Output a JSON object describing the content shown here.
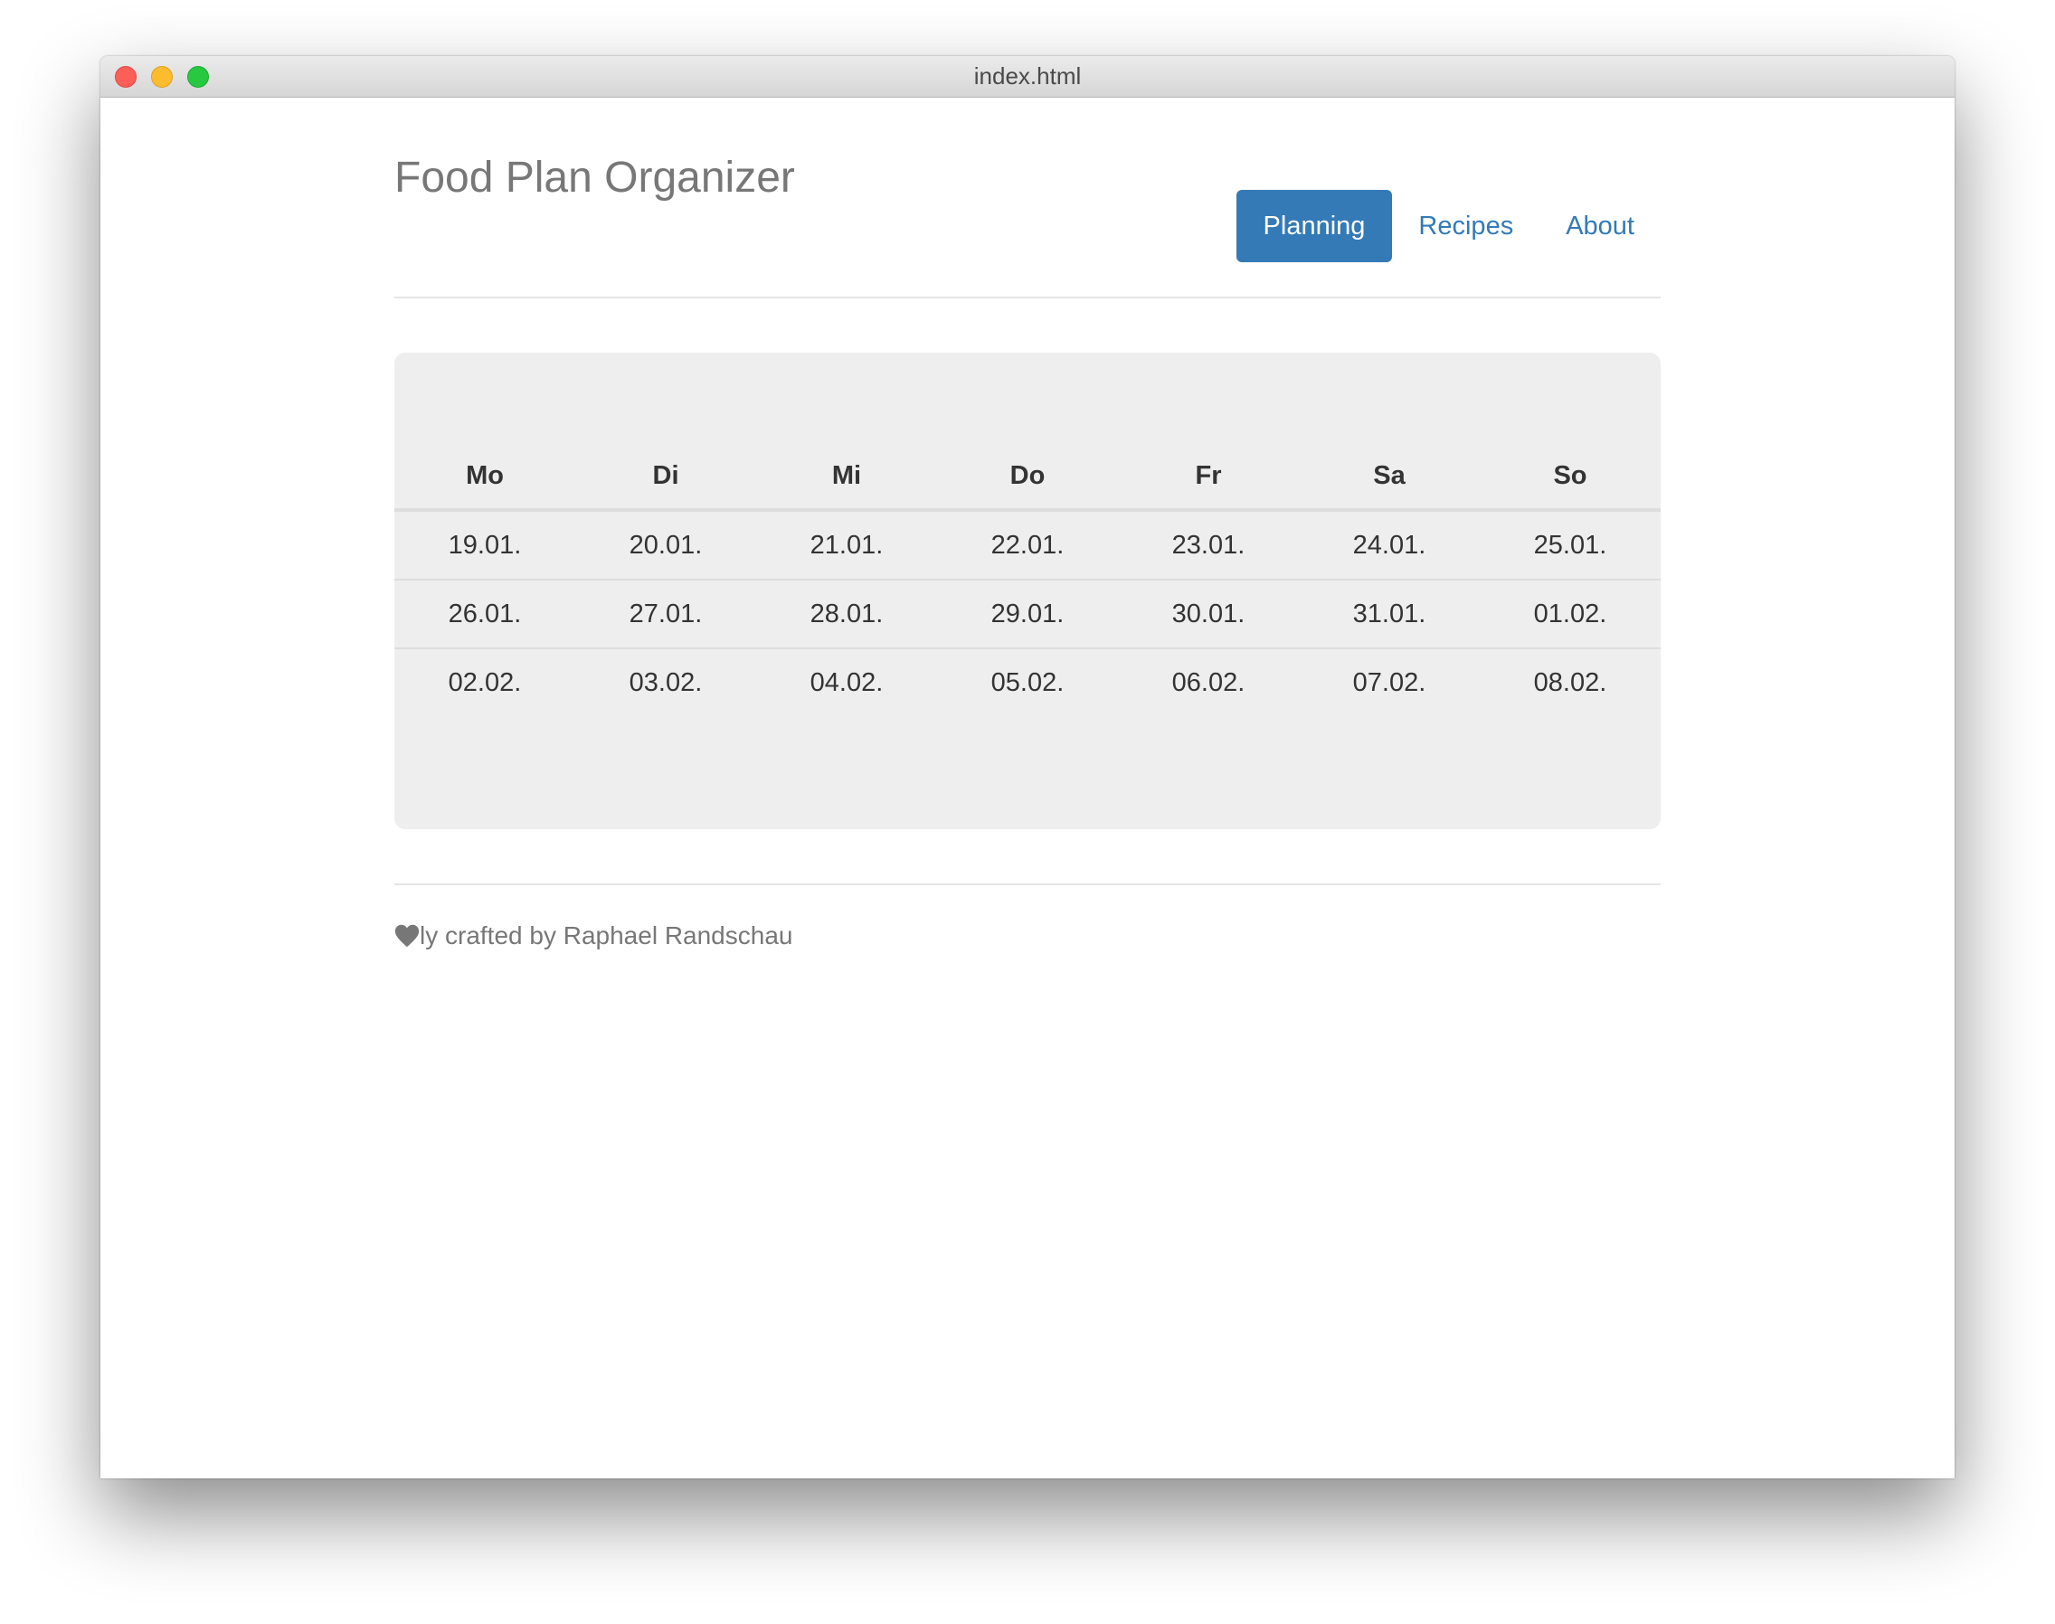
{
  "window": {
    "title": "index.html"
  },
  "header": {
    "brand": "Food Plan Organizer",
    "nav": [
      {
        "label": "Planning",
        "active": true
      },
      {
        "label": "Recipes",
        "active": false
      },
      {
        "label": "About",
        "active": false
      }
    ]
  },
  "calendar": {
    "days": [
      "Mo",
      "Di",
      "Mi",
      "Do",
      "Fr",
      "Sa",
      "So"
    ],
    "weeks": [
      [
        "19.01.",
        "20.01.",
        "21.01.",
        "22.01.",
        "23.01.",
        "24.01.",
        "25.01."
      ],
      [
        "26.01.",
        "27.01.",
        "28.01.",
        "29.01.",
        "30.01.",
        "31.01.",
        "01.02."
      ],
      [
        "02.02.",
        "03.02.",
        "04.02.",
        "05.02.",
        "06.02.",
        "07.02.",
        "08.02."
      ]
    ]
  },
  "footer": {
    "icon": "heart-icon",
    "text": "ly crafted by Raphael Randschau"
  },
  "colors": {
    "accent": "#337ab7",
    "muted": "#777777",
    "panel": "#eeeeee"
  }
}
